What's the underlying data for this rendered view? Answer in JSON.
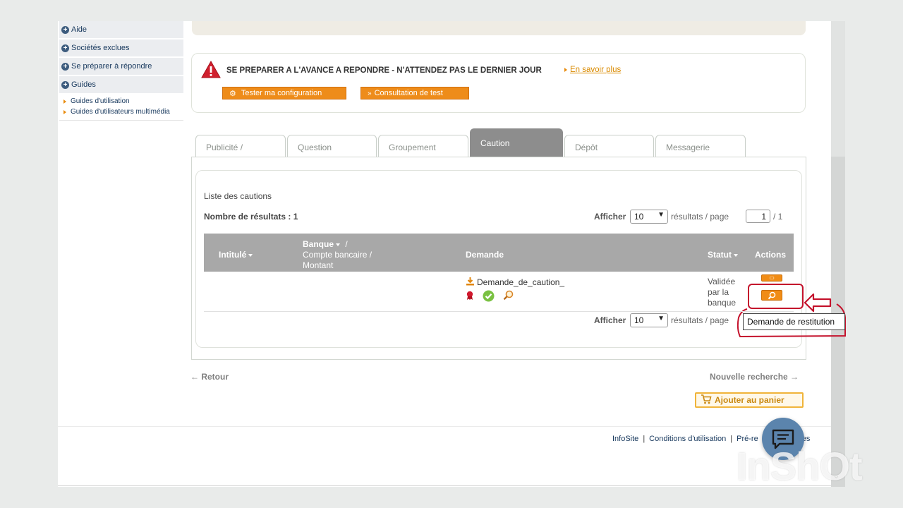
{
  "sidebar": {
    "items": [
      {
        "label": "Aide"
      },
      {
        "label": "Sociétés exclues"
      },
      {
        "label": "Se préparer à répondre"
      },
      {
        "label": "Guides"
      }
    ],
    "guides_sub": [
      {
        "label": "Guides d'utilisation"
      },
      {
        "label": "Guides d'utilisateurs multimédia"
      }
    ]
  },
  "alert": {
    "text": "SE PREPARER A L'AVANCE A REPONDRE - N'ATTENDEZ PAS LE DERNIER JOUR",
    "link": "En savoir plus",
    "buttons": {
      "test": "Tester ma configuration",
      "consult": "Consultation de test"
    }
  },
  "tabs": [
    {
      "label": "Publicité /"
    },
    {
      "label": "Question"
    },
    {
      "label": "Groupement"
    },
    {
      "label": "Caution",
      "active": true
    },
    {
      "label": "Dépôt"
    },
    {
      "label": "Messagerie"
    }
  ],
  "list": {
    "title": "Liste des cautions",
    "results": "Nombre de résultats : 1",
    "show_label": "Afficher",
    "per_page_value": "10",
    "per_page_suffix": "résultats / page",
    "page_current": "1",
    "page_total": "/ 1"
  },
  "table": {
    "headers": {
      "intitule": "Intitulé",
      "banque": "Banque",
      "banque_slash": "/",
      "compte": "Compte bancaire /",
      "montant": "Montant",
      "demande": "Demande",
      "statut": "Statut",
      "actions": "Actions"
    },
    "rows": [
      {
        "demande_file": "Demande_de_caution_",
        "statut_lines": [
          "Validée",
          "par la",
          "banque"
        ]
      }
    ]
  },
  "tooltip": "Demande de restitution",
  "nav": {
    "back": "← Retour",
    "new_search": "Nouvelle recherche →",
    "cart": "Ajouter au panier"
  },
  "footer": {
    "links": [
      "InfoSite",
      "Conditions d'utilisation",
      "Pré-re",
      "es"
    ]
  },
  "watermark": "InShOt",
  "colors": {
    "accent_orange": "#ee8c1a",
    "highlight_red": "#c4122c",
    "table_header": "#a8a8a8",
    "link_blue": "#16375c"
  },
  "icons": [
    "plus-circle-icon",
    "warning-triangle-icon",
    "config-icon",
    "double-chevron-icon",
    "download-icon",
    "ribbon-icon",
    "check-circle-icon",
    "magnifier-icon",
    "cart-icon",
    "chat-icon",
    "chevron-down-icon",
    "left-arrow-icon"
  ]
}
